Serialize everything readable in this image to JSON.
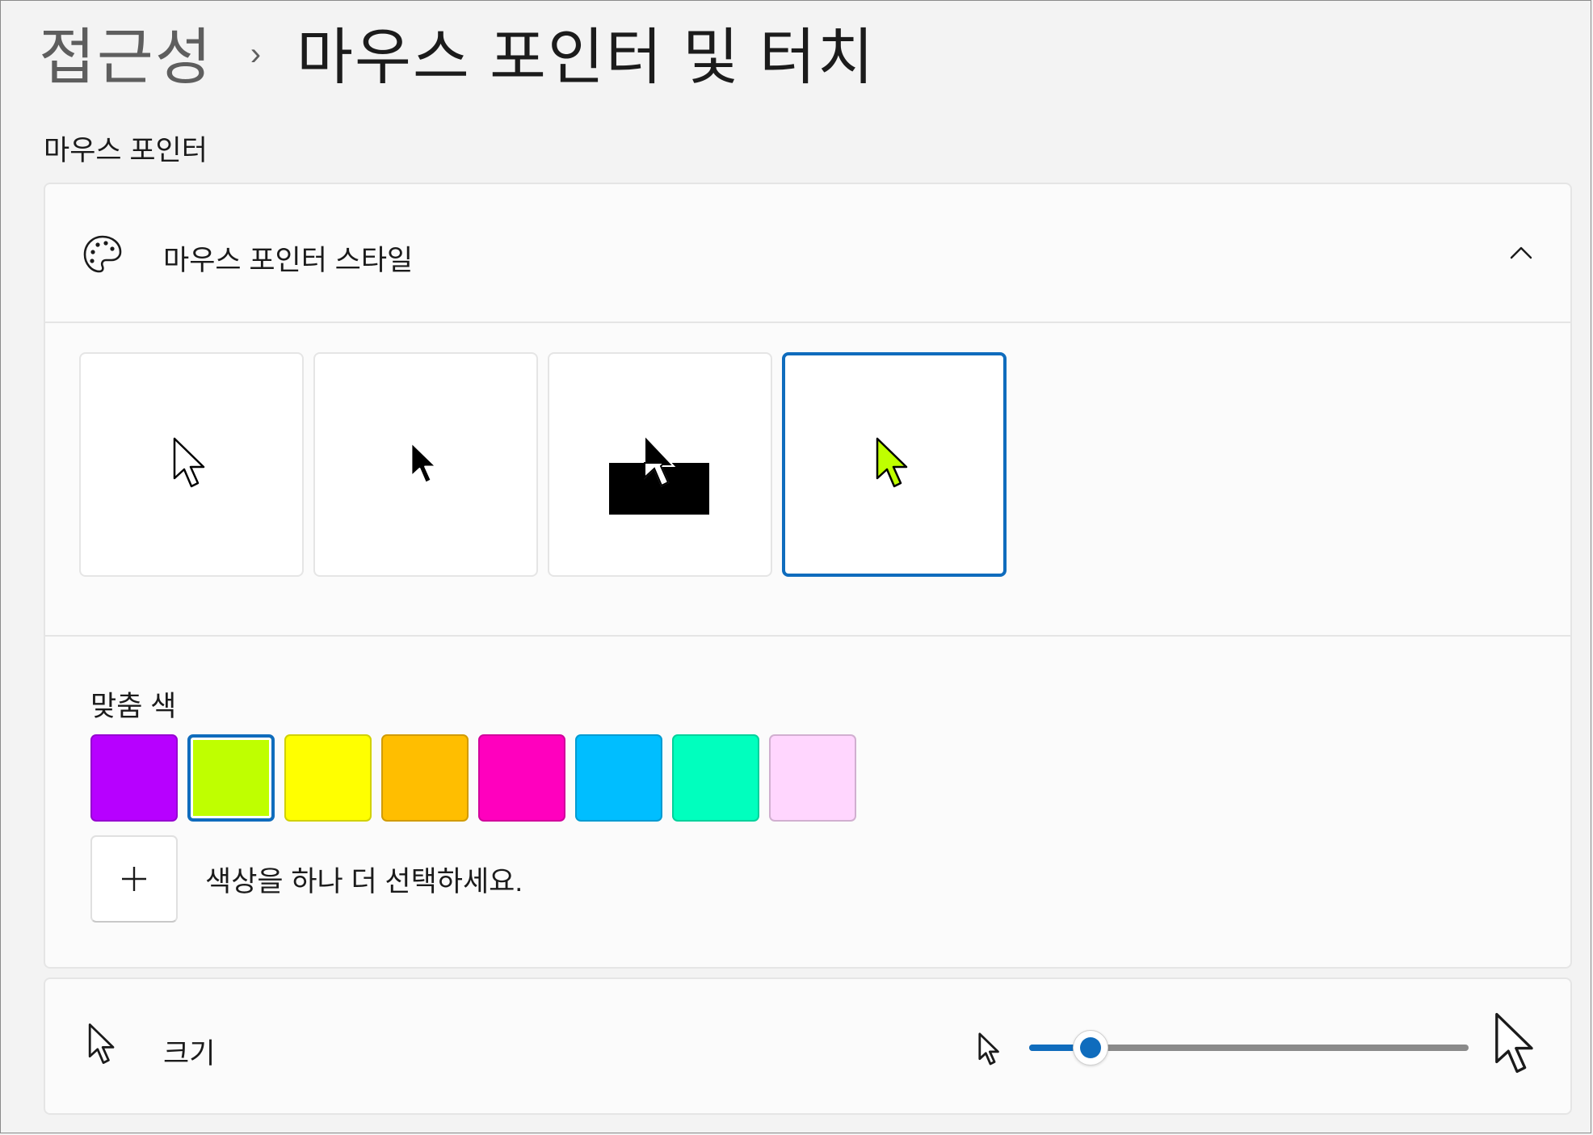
{
  "breadcrumb": {
    "parent": "접근성",
    "separator": "›",
    "current": "마우스 포인터 및 터치"
  },
  "mouse_pointer_section": {
    "heading": "마우스 포인터",
    "style_card": {
      "title": "마우스 포인터 스타일",
      "icon": "palette-icon",
      "expanded": true,
      "styles": [
        {
          "name": "white",
          "selected": false
        },
        {
          "name": "black",
          "selected": false
        },
        {
          "name": "inverted",
          "selected": false
        },
        {
          "name": "custom",
          "selected": true
        }
      ],
      "custom_colors": {
        "label": "맞춤 색",
        "swatches": [
          "#b700ff",
          "#bfff00",
          "#ffff00",
          "#ffbe00",
          "#ff00be",
          "#00beff",
          "#00ffbe",
          "#ffd6fe"
        ],
        "selected_index": 1,
        "add_label": "색상을 하나 더 선택하세요."
      }
    },
    "size_card": {
      "label": "크기",
      "icon": "pointer-icon",
      "slider_fraction": 0.14
    }
  },
  "colors": {
    "accent": "#0f6cbd",
    "custom_pointer": "#bfff00"
  }
}
